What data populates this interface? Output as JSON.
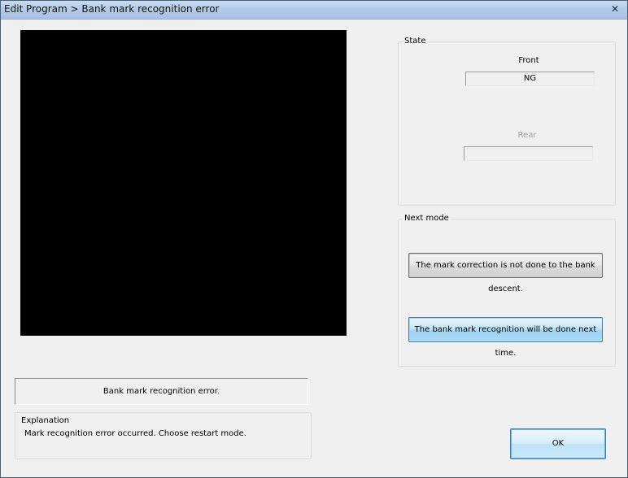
{
  "window": {
    "title": "Edit Program > Bank mark recognition error",
    "close_glyph": "✕"
  },
  "state": {
    "legend": "State",
    "front": {
      "label": "Front",
      "value": "NG"
    },
    "rear": {
      "label": "Rear",
      "value": ""
    }
  },
  "next_mode": {
    "legend": "Next mode",
    "skip_correction_label": "The mark correction is not done to the bank descent.",
    "retry_recognition_label": "The bank mark recognition will be done next time."
  },
  "message": "Bank mark recognition error.",
  "explanation": {
    "legend": "Explanation",
    "text": "Mark recognition error occurred. Choose restart mode."
  },
  "actions": {
    "ok_label": "OK"
  }
}
